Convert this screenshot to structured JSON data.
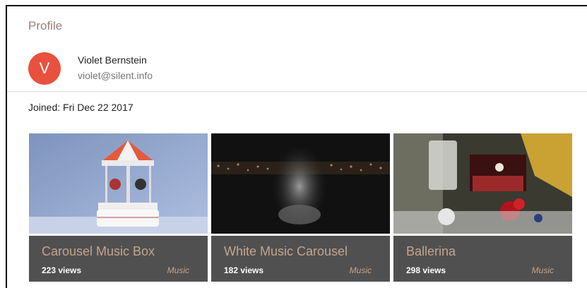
{
  "header": {
    "title": "Profile"
  },
  "user": {
    "avatar_letter": "V",
    "name": "Violet Bernstein",
    "email": "violet@silent.info",
    "joined": "Joined: Fri Dec 22 2017"
  },
  "colors": {
    "avatar": "#e8513e",
    "card_bg": "#505050",
    "accent": "#c4a58c"
  },
  "videos": [
    {
      "title": "Carousel Music Box",
      "views": "223 views",
      "category": "Music",
      "thumbnail": "carousel-music-box-photo"
    },
    {
      "title": "White Music Carousel",
      "views": "182 views",
      "category": "Music",
      "thumbnail": "blurred-carousel-night-photo"
    },
    {
      "title": "Ballerina",
      "views": "298 views",
      "category": "Music",
      "thumbnail": "ballerina-jewelry-box-photo"
    }
  ]
}
